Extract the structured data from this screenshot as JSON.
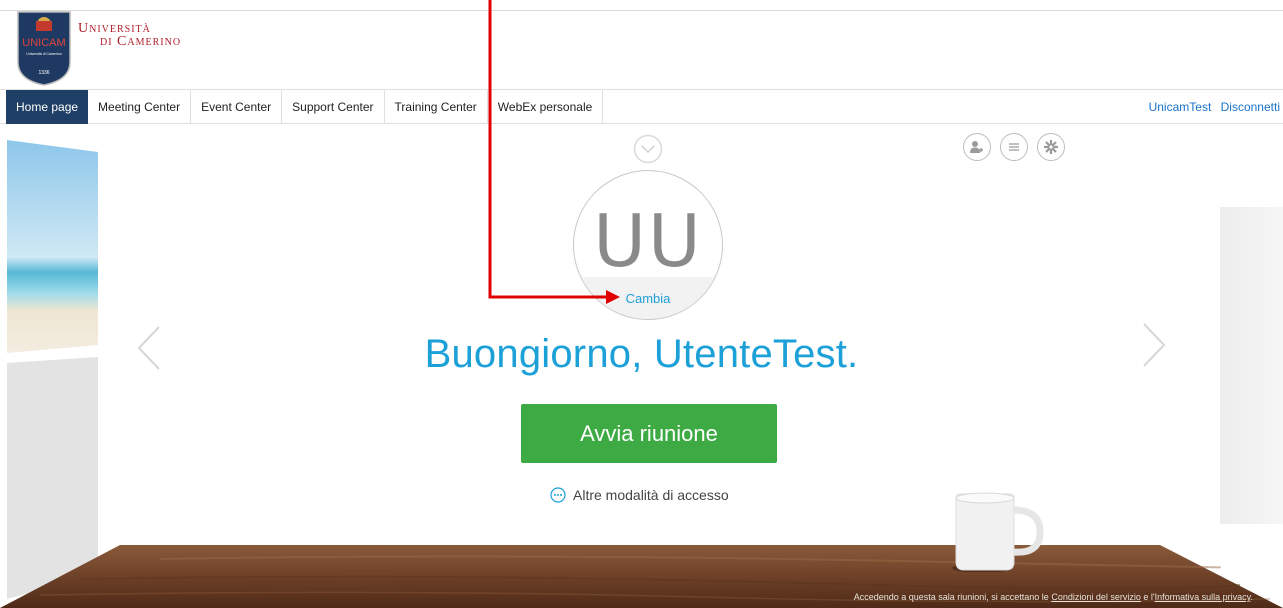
{
  "brand": {
    "shield_text": "UNICAM",
    "shield_subtext": "Università di Camerino",
    "shield_year": "1336",
    "name_line1": "Università",
    "name_line2": "di Camerino"
  },
  "nav": {
    "tabs": [
      {
        "label": "Home page",
        "active": true
      },
      {
        "label": "Meeting Center",
        "active": false
      },
      {
        "label": "Event Center",
        "active": false
      },
      {
        "label": "Support Center",
        "active": false
      },
      {
        "label": "Training Center",
        "active": false
      },
      {
        "label": "WebEx personale",
        "active": false
      }
    ],
    "user_link": "UnicamTest",
    "logout_link": "Disconnetti"
  },
  "room": {
    "avatar_initials": "UU",
    "avatar_change": "Cambia",
    "greeting": "Buongiorno, UtenteTest.",
    "start_button": "Avvia riunione",
    "alt_access": "Altre modalità di accesso",
    "top_icons": [
      "add-user-icon",
      "list-icon",
      "settings-gear-icon"
    ]
  },
  "footer": {
    "prefix": "Accedendo a questa sala riunioni, si accettano le ",
    "terms_link": "Condizioni del servizio",
    "conjunction": " e l'",
    "privacy_link": "Informativa sulla privacy",
    "suffix": "."
  },
  "colors": {
    "accent_blue": "#1ba0d7",
    "nav_active": "#1f3f66",
    "start_green": "#3eaa43",
    "brand_red": "#b11c2a",
    "annotation_red": "#e00000"
  }
}
